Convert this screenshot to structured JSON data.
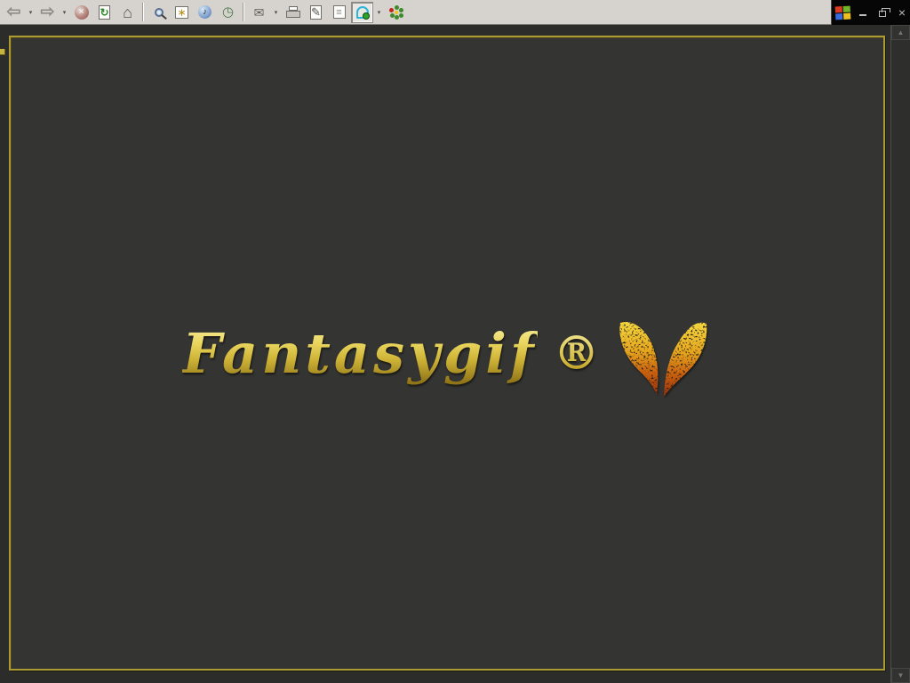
{
  "toolbar": {
    "back_glyph": "⇦",
    "forward_glyph": "⇨",
    "dropdown_glyph": "▾",
    "stop_glyph": "×",
    "refresh_glyph": "↻",
    "home_glyph": "⌂",
    "favorites_glyph": "∗",
    "media_glyph": "♪",
    "history_glyph": "◷",
    "mail_glyph": "✉",
    "edit_glyph": "✎",
    "discuss_glyph": "≡"
  },
  "window_controls": {
    "close_glyph": "×"
  },
  "scrollbar": {
    "up_glyph": "▲",
    "down_glyph": "▼"
  },
  "page": {
    "logo_text": "Fantasygif",
    "registered_mark": "®"
  },
  "colors": {
    "toolbar_bg": "#d6d3ce",
    "titlebar_bg": "#060606",
    "page_bg": "#343432",
    "outer_bg": "#2c2c2a",
    "frame_gold": "#ac9a34",
    "logo_gold": "#e8d45c",
    "butterfly_gold": "#f2cf3a",
    "butterfly_orange": "#cc6410",
    "butterfly_red": "#992f06"
  }
}
